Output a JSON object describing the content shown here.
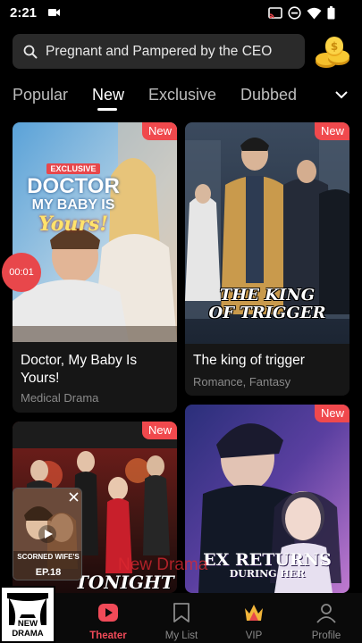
{
  "status": {
    "time": "2:21"
  },
  "search": {
    "query": "Pregnant and Pampered by the CEO"
  },
  "tabs": [
    {
      "label": "Popular"
    },
    {
      "label": "New"
    },
    {
      "label": "Exclusive"
    },
    {
      "label": "Dubbed"
    }
  ],
  "active_tab": "New",
  "cards": [
    {
      "badge": "New",
      "title": "Doctor, My Baby Is Yours!",
      "genre": "Medical Drama",
      "poster_text": [
        "EXCLUSIVE",
        "DOCTOR",
        "MY BABY IS",
        "Yours!"
      ]
    },
    {
      "badge": "New",
      "title": "The king of trigger",
      "genre": "Romance, Fantasy",
      "poster_text": [
        "THE KING",
        "OF TRIGGER"
      ]
    },
    {
      "badge": "New",
      "poster_text": [
        "TONIGHT"
      ]
    },
    {
      "badge": "New",
      "poster_text": [
        "EX RETURNS",
        "DURING HER"
      ]
    }
  ],
  "player": {
    "timer": "00:01"
  },
  "mini_player": {
    "title": "SCORNED WIFE'S",
    "episode": "EP.18"
  },
  "watermark": "New Drama",
  "logo_text": "NEW DRAMA",
  "nav": [
    {
      "label": "Theater",
      "icon": "theater-icon"
    },
    {
      "label": "My List",
      "icon": "bookmark-icon"
    },
    {
      "label": "VIP",
      "icon": "vip-crown-icon"
    },
    {
      "label": "Profile",
      "icon": "profile-icon"
    }
  ],
  "colors": {
    "accent": "#f04a58",
    "badge": "#f0494d",
    "background": "#000000"
  }
}
